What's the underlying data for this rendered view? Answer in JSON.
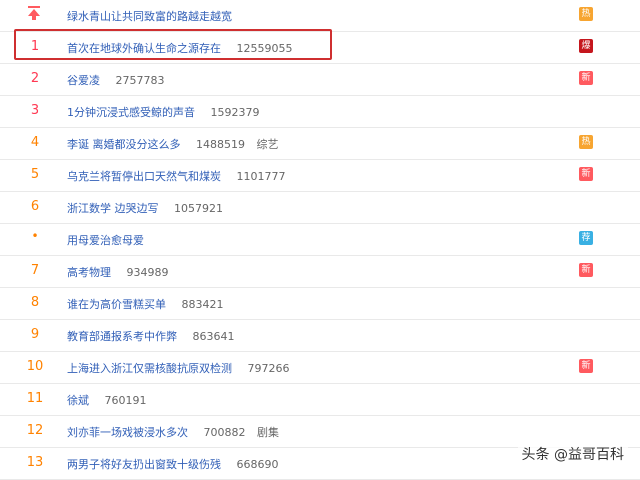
{
  "rows": [
    {
      "rank": "",
      "title": "绿水青山让共同致富的路越走越宽",
      "count": "",
      "category": "",
      "badge": "热",
      "badge_type": "hot",
      "pinned": true
    },
    {
      "rank": "1",
      "title": "首次在地球外确认生命之源存在",
      "count": "12559055",
      "category": "",
      "badge": "爆",
      "badge_type": "boom"
    },
    {
      "rank": "2",
      "title": "谷爱凌",
      "count": "2757783",
      "category": "",
      "badge": "新",
      "badge_type": "new"
    },
    {
      "rank": "3",
      "title": "1分钟沉浸式感受鲸的声音",
      "count": "1592379",
      "category": "",
      "badge": "",
      "badge_type": ""
    },
    {
      "rank": "4",
      "title": "李诞 离婚都没分这么多",
      "count": "1488519",
      "category": "综艺",
      "badge": "热",
      "badge_type": "hot"
    },
    {
      "rank": "5",
      "title": "乌克兰将暂停出口天然气和煤炭",
      "count": "1101777",
      "category": "",
      "badge": "新",
      "badge_type": "new"
    },
    {
      "rank": "6",
      "title": "浙江数学 边哭边写",
      "count": "1057921",
      "category": "",
      "badge": "",
      "badge_type": ""
    },
    {
      "rank": "•",
      "title": "用母爱治愈母爱",
      "count": "",
      "category": "",
      "badge": "荐",
      "badge_type": "rec"
    },
    {
      "rank": "7",
      "title": "高考物理",
      "count": "934989",
      "category": "",
      "badge": "新",
      "badge_type": "new"
    },
    {
      "rank": "8",
      "title": "谁在为高价雪糕买单",
      "count": "883421",
      "category": "",
      "badge": "",
      "badge_type": ""
    },
    {
      "rank": "9",
      "title": "教育部通报系考中作弊",
      "count": "863641",
      "category": "",
      "badge": "",
      "badge_type": ""
    },
    {
      "rank": "10",
      "title": "上海进入浙江仅需核酸抗原双检测",
      "count": "797266",
      "category": "",
      "badge": "新",
      "badge_type": "new"
    },
    {
      "rank": "11",
      "title": "徐斌",
      "count": "760191",
      "category": "",
      "badge": "",
      "badge_type": ""
    },
    {
      "rank": "12",
      "title": "刘亦菲一场戏被浸水多次",
      "count": "700882",
      "category": "剧集",
      "badge": "",
      "badge_type": ""
    },
    {
      "rank": "13",
      "title": "两男子将好友扔出窗致十级伤残",
      "count": "668690",
      "category": "",
      "badge": "",
      "badge_type": ""
    }
  ],
  "watermark": "头条 @益哥百科",
  "colors": {
    "title": "#315fb7",
    "rank_top": "#ff3852",
    "rank": "#ff8200",
    "highlight": "#cf2f30"
  }
}
